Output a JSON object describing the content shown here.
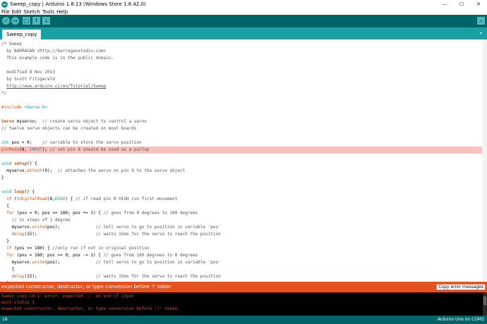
{
  "window": {
    "title": "Sweep_copy | Arduino 1.8.13 (Windows Store 1.8.42.0)",
    "controls": {
      "minimize": "—",
      "maximize": "☐",
      "close": "✕"
    }
  },
  "menu": {
    "items": [
      {
        "label": "File"
      },
      {
        "label": "Edit"
      },
      {
        "label": "Sketch"
      },
      {
        "label": "Tools"
      },
      {
        "label": "Help"
      }
    ]
  },
  "toolbar": {
    "verify_glyph": "✓",
    "upload_glyph": "→",
    "new_glyph": "▢",
    "open_glyph": "↑",
    "save_glyph": "↓",
    "serial_glyph": "⌕",
    "accent": "#006468",
    "button_color": "#4db7bb"
  },
  "tabs": {
    "active": "Sweep_copy",
    "menu_glyph": "▾"
  },
  "editor": {
    "highlight_color": "#f8c1bf",
    "lines": [
      {
        "html": "<span class=\"c\">/* Sweep</span>"
      },
      {
        "html": "<span class=\"c\">  by BARRAGAN &lt;http://barraganstudio.com&gt;</span>"
      },
      {
        "html": "<span class=\"c\">  This example code is in the public domain.</span>"
      },
      {
        "html": ""
      },
      {
        "html": "<span class=\"c\">  modified 8 Nov 2013</span>"
      },
      {
        "html": "<span class=\"c\">  by Scott Fitzgerald</span>"
      },
      {
        "html": "<span class=\"c\">  </span><span class=\"u\">http://www.arduino.cc/en/Tutorial/Sweep</span>"
      },
      {
        "html": "<span class=\"c\">*/</span>"
      },
      {
        "html": ""
      },
      {
        "html": "<span class=\"k\">#include</span> <span class=\"s\">&lt;Servo.h&gt;</span>"
      },
      {
        "html": ""
      },
      {
        "html": "<span class=\"kb\">Servo</span> myservo;  <span class=\"c\">// create servo object to control a servo</span>"
      },
      {
        "html": "<span class=\"c\">// twelve servo objects can be created on most boards</span>"
      },
      {
        "html": ""
      },
      {
        "html": "<span class=\"s\">int</span> pos = 0;    <span class=\"c\">// variable to store the servo position</span>"
      },
      {
        "html": "<span class=\"f\">pinMode</span>(8, <span class=\"s\">INPUT</span>); <span class=\"c\">// set pin 8 should be used as a pullup</span>",
        "highlight": true
      },
      {
        "html": ""
      },
      {
        "html": "<span class=\"s\">void</span> <span class=\"kb\">setup</span>() {"
      },
      {
        "html": "  myservo.<span class=\"f\">attach</span>(9);  <span class=\"c\">// attaches the servo on pin 9 to the servo object</span>"
      },
      {
        "html": "}"
      },
      {
        "html": ""
      },
      {
        "html": "<span class=\"s\">void</span> <span class=\"kb\">loop</span>() {"
      },
      {
        "html": "  <span class=\"k\">if</span> (!<span class=\"f\">digitalRead</span>(8,<span class=\"s\">HIGH</span>) { <span class=\"c\">// if read pin 8 HIGH run first movement</span>"
      },
      {
        "html": "  {"
      },
      {
        "html": "  <span class=\"k\">for</span> (pos = 0; pos &lt;= 180; pos += 1) { <span class=\"c\">// goes from 0 degrees to 180 degrees</span>"
      },
      {
        "html": "    <span class=\"c\">// in steps of 1 degree</span>"
      },
      {
        "html": "    myservo.<span class=\"f\">write</span>(pos);              <span class=\"c\">// tell servo to go to position in variable 'pos'</span>"
      },
      {
        "html": "    <span class=\"f\">delay</span>(15);                       <span class=\"c\">// waits 15ms for the servo to reach the position</span>"
      },
      {
        "html": "  }"
      },
      {
        "html": "  <span class=\"k\">if</span> (pos &gt;= 180) { <span class=\"c\">//only run if not in original position</span>"
      },
      {
        "html": "  <span class=\"k\">for</span> (pos = 180; pos &gt;= 0; pos -= 1) { <span class=\"c\">// goes from 180 degrees to 0 degrees</span>"
      },
      {
        "html": "    myservo.<span class=\"f\">write</span>(pos);              <span class=\"c\">// tell servo to go to position in variable 'pos'</span>"
      },
      {
        "html": "    {"
      },
      {
        "html": "    <span class=\"f\">delay</span>(15);                       <span class=\"c\">// waits 15ms for the servo to reach the position</span>"
      },
      {
        "html": "  }"
      },
      {
        "html": "}"
      }
    ]
  },
  "status": {
    "message": "expected constructor, destructor, or type conversion before '(' token",
    "copy_button": "Copy error messages",
    "color": "#e5521f"
  },
  "console": {
    "lines": [
      "Sweep_copy:18:1: error: expected ';' at end of input",
      "exit status 1",
      "expected constructor, destructor, or type conversion before '(' token"
    ],
    "text_color": "#e34c22"
  },
  "footer": {
    "line_number": "16",
    "board": "Arduino Uno on COM3"
  }
}
